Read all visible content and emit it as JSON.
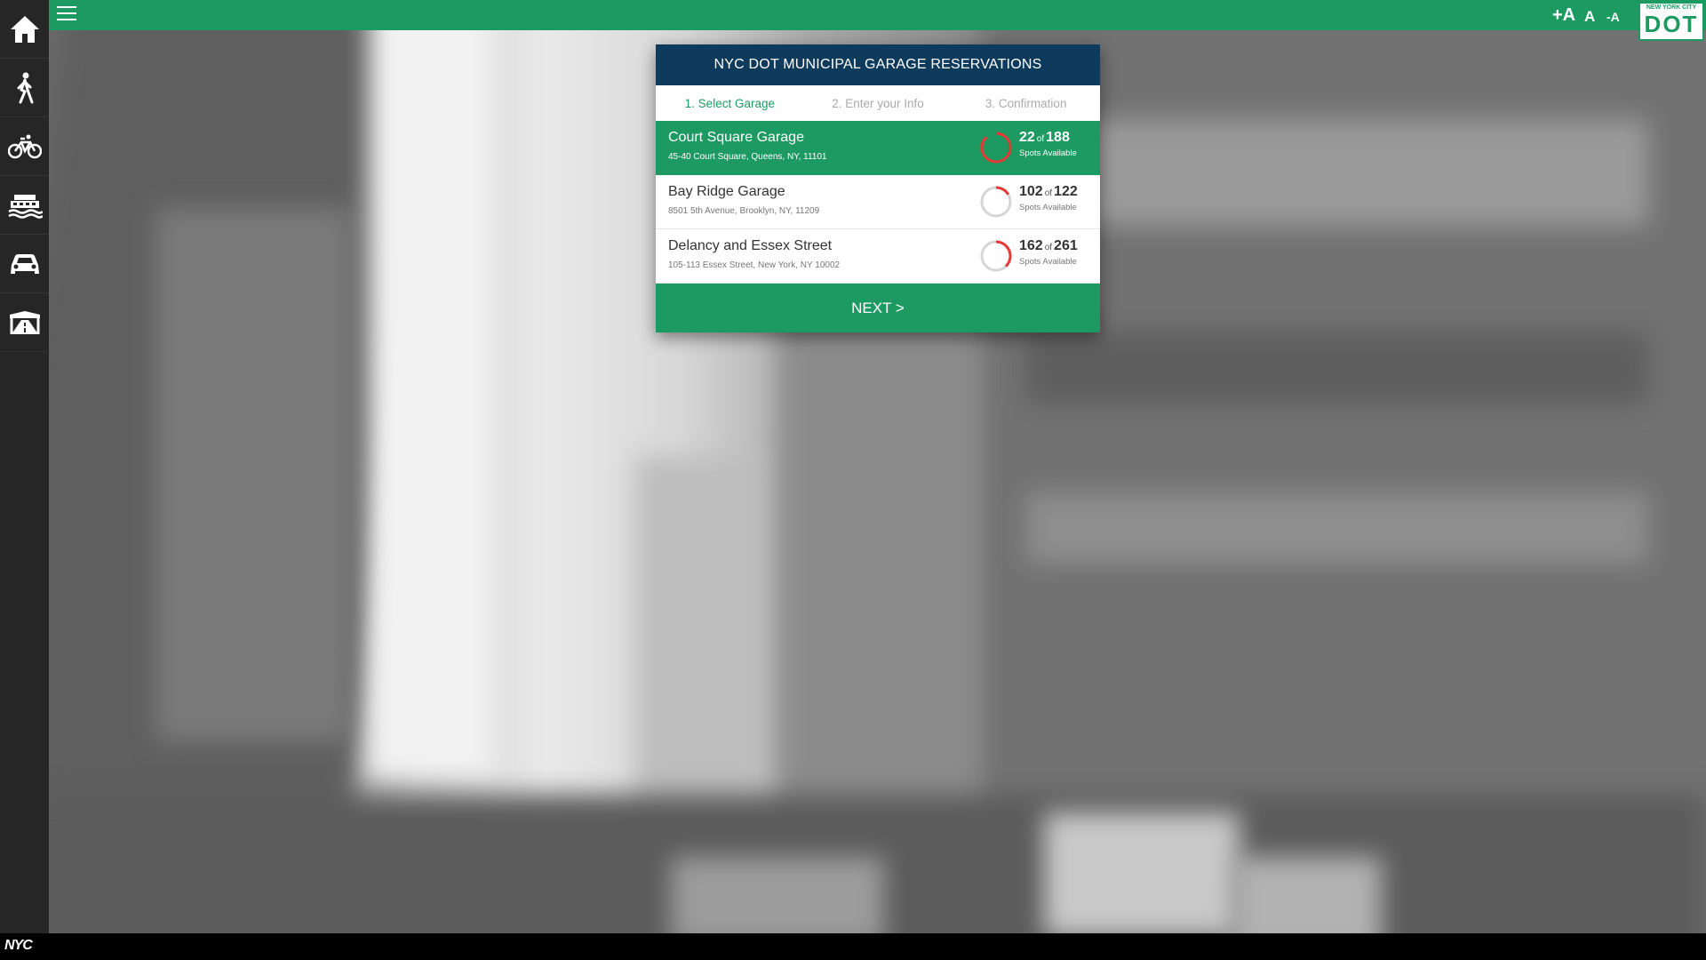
{
  "app": {
    "title": "NYC DOT MUNICIPAL GARAGE RESERVATIONS",
    "brand_color": "#1c9a62",
    "header_color": "#0e3a5c",
    "accent_red": "#e53935"
  },
  "topbar": {
    "menu_icon": "hamburger-icon",
    "font_controls": [
      "+A",
      "A",
      "-A"
    ],
    "logo_text_top": "NEW YORK CITY",
    "logo_text": "DOT"
  },
  "sidebar": {
    "items": [
      {
        "name": "home",
        "icon": "home-icon"
      },
      {
        "name": "pedestrian",
        "icon": "pedestrian-icon"
      },
      {
        "name": "bicycle",
        "icon": "bicycle-icon"
      },
      {
        "name": "ferry",
        "icon": "ferry-icon"
      },
      {
        "name": "car",
        "icon": "car-icon"
      },
      {
        "name": "bridge",
        "icon": "bridge-icon"
      }
    ]
  },
  "steps": [
    {
      "label": "1. Select Garage",
      "active": true
    },
    {
      "label": "2. Enter your Info",
      "active": false
    },
    {
      "label": "3. Confirmation",
      "active": false
    }
  ],
  "garages": [
    {
      "name": "Court Square Garage",
      "address": "45-40 Court Square, Queens, NY, 11101",
      "available": "22",
      "of": "of",
      "total": "188",
      "label": "Spots Available",
      "fraction": 0.117,
      "selected": true
    },
    {
      "name": "Bay Ridge Garage",
      "address": "8501 5th Avenue, Brooklyn, NY, 11209",
      "available": "102",
      "of": "of",
      "total": "122",
      "label": "Spots Available",
      "fraction": 0.836,
      "selected": false
    },
    {
      "name": "Delancy and Essex Street",
      "address": "105-113 Essex Street, New York, NY 10002",
      "available": "162",
      "of": "of",
      "total": "261",
      "label": "Spots Available",
      "fraction": 0.621,
      "selected": false
    }
  ],
  "next_label": "NEXT >",
  "footer": {
    "logo": "NYC"
  }
}
